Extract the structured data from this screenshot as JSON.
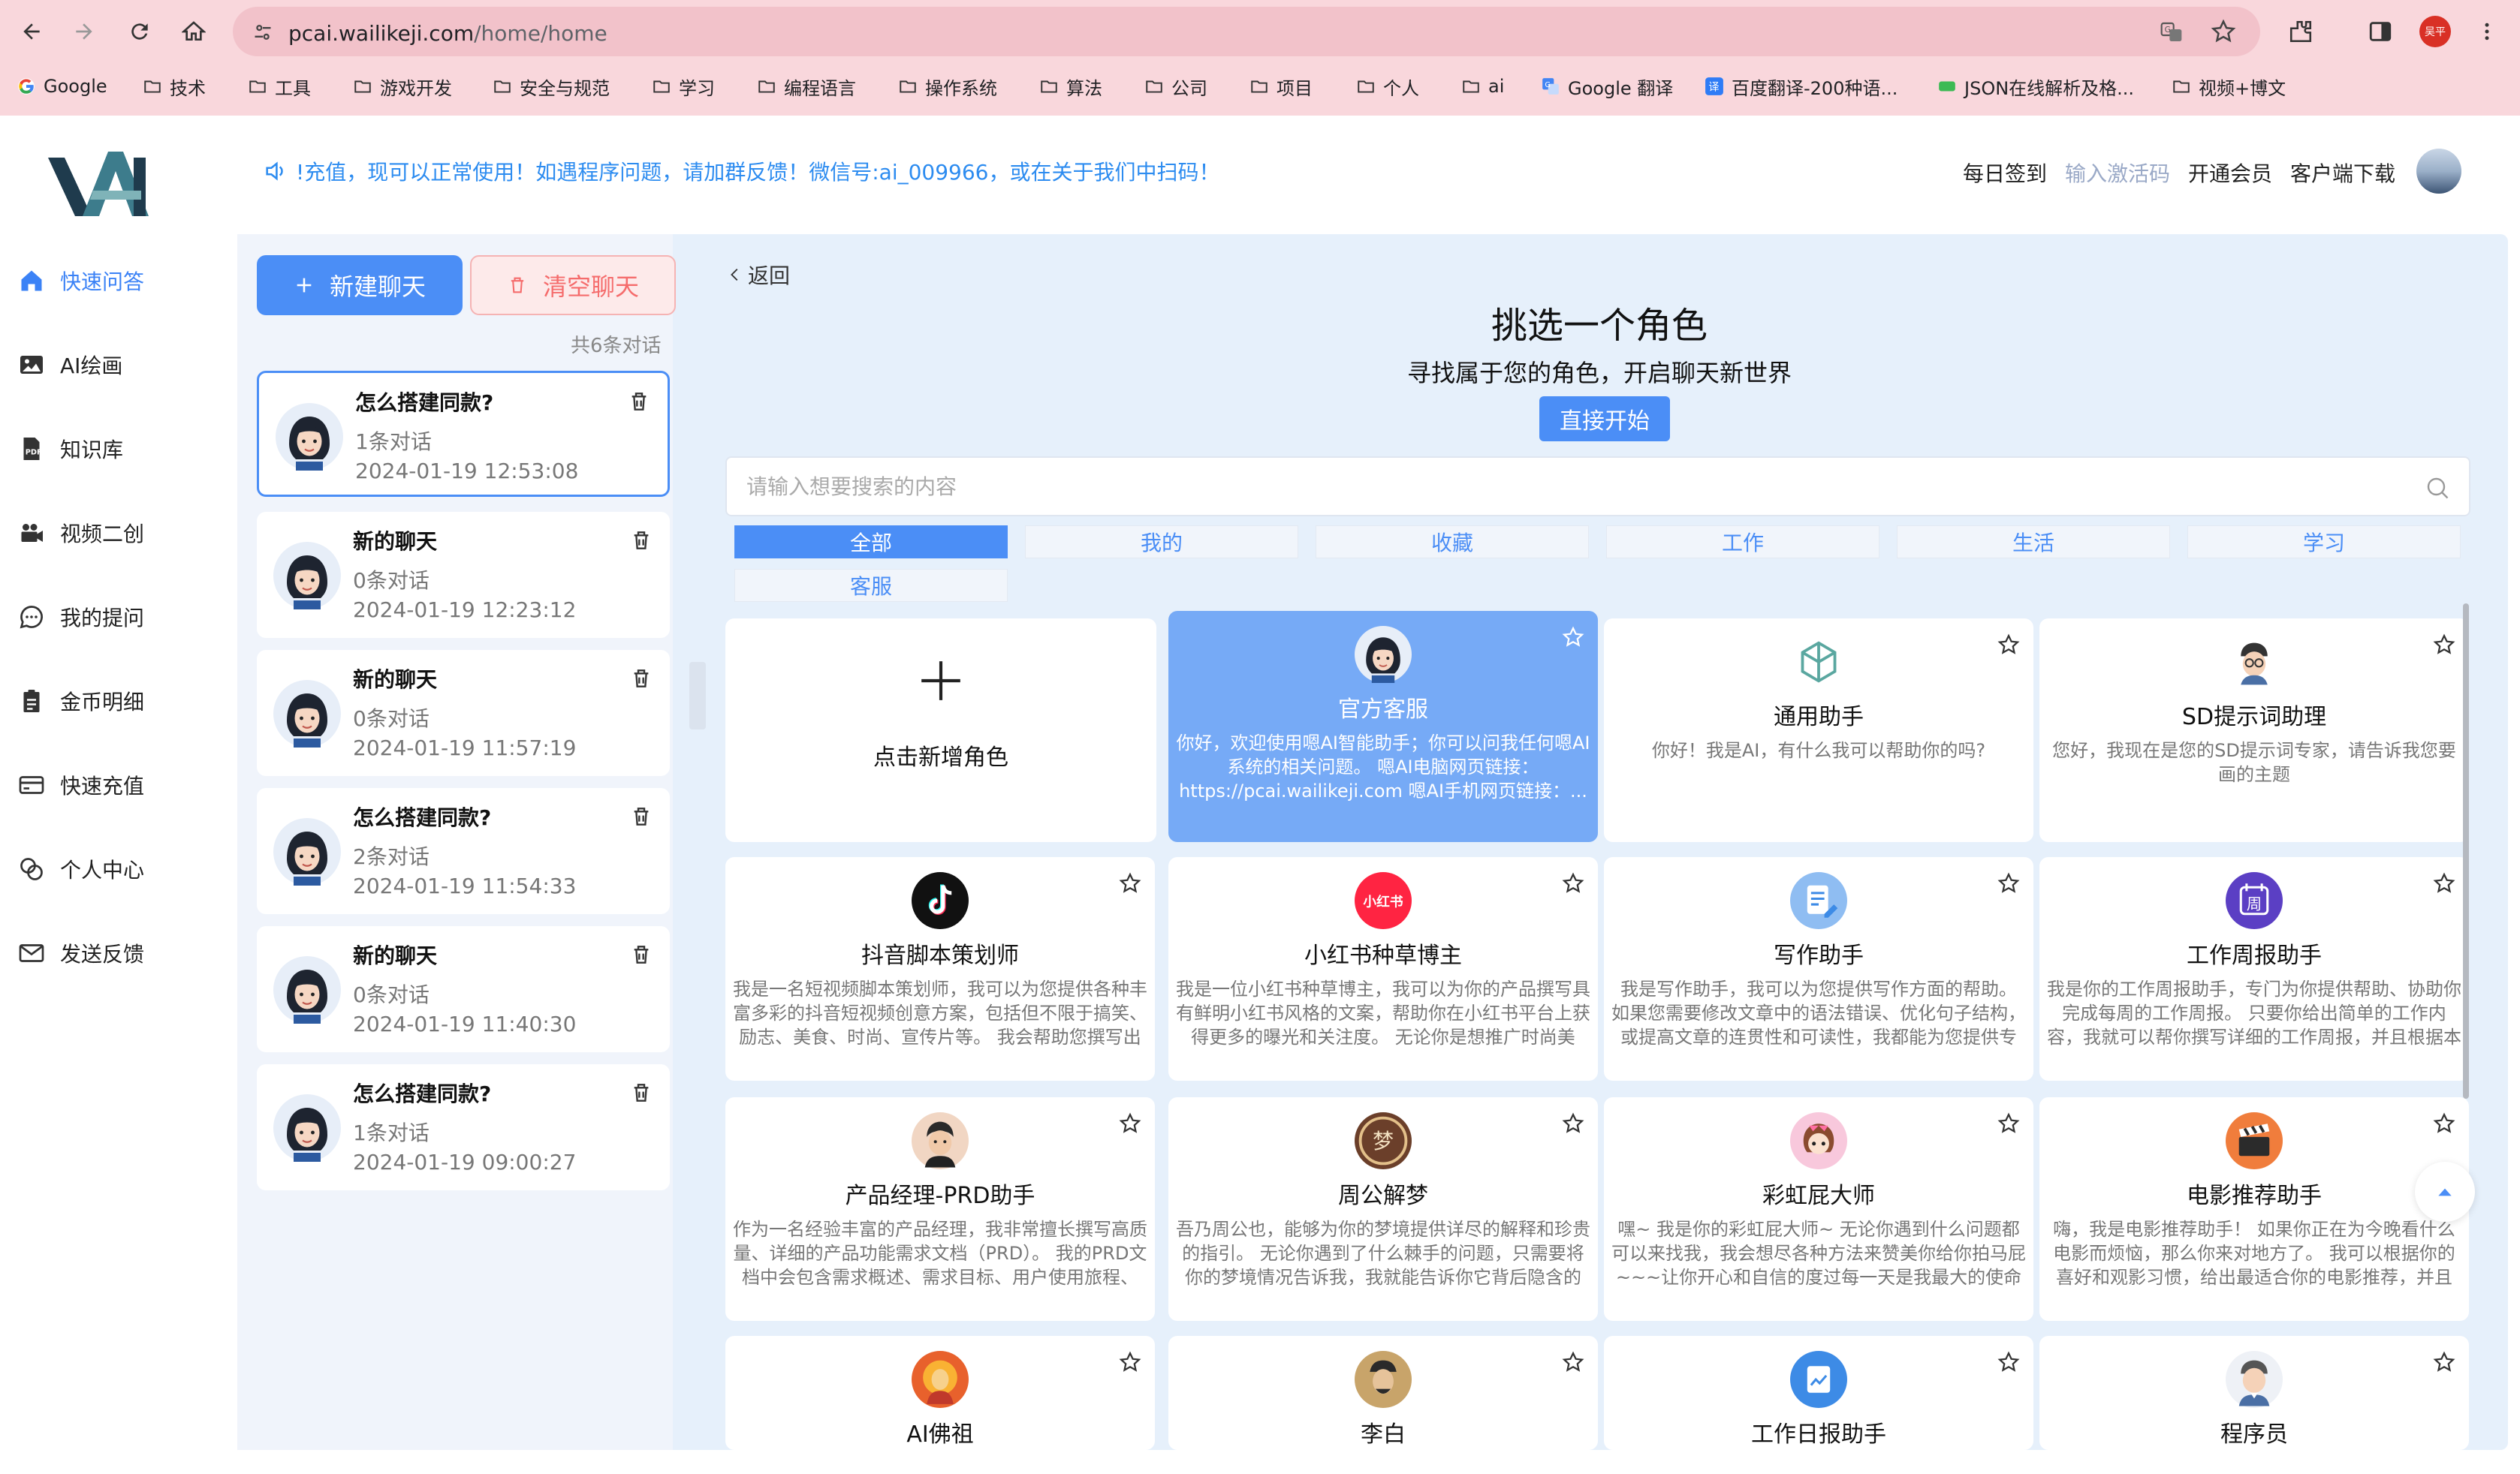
{
  "browser": {
    "url_host": "pcai.wailikeji.com",
    "url_path": "/home/home",
    "profile_label": "吴平",
    "bookmarks": [
      {
        "label": "Google",
        "icon": "google-icon"
      },
      {
        "label": "技术",
        "icon": "folder-icon"
      },
      {
        "label": "工具",
        "icon": "folder-icon"
      },
      {
        "label": "游戏开发",
        "icon": "folder-icon"
      },
      {
        "label": "安全与规范",
        "icon": "folder-icon"
      },
      {
        "label": "学习",
        "icon": "folder-icon"
      },
      {
        "label": "编程语言",
        "icon": "folder-icon"
      },
      {
        "label": "操作系统",
        "icon": "folder-icon"
      },
      {
        "label": "算法",
        "icon": "folder-icon"
      },
      {
        "label": "公司",
        "icon": "folder-icon"
      },
      {
        "label": "项目",
        "icon": "folder-icon"
      },
      {
        "label": "个人",
        "icon": "folder-icon"
      },
      {
        "label": "ai",
        "icon": "folder-icon"
      },
      {
        "label": "Google 翻译",
        "icon": "translate-icon"
      },
      {
        "label": "百度翻译-200种语...",
        "icon": "baidu-translate-icon"
      },
      {
        "label": "JSON在线解析及格...",
        "icon": "json-icon"
      },
      {
        "label": "视频+博文",
        "icon": "folder-icon"
      }
    ]
  },
  "sidebar": {
    "items": [
      {
        "label": "快速问答",
        "icon": "home-icon",
        "active": true
      },
      {
        "label": "AI绘画",
        "icon": "image-icon"
      },
      {
        "label": "知识库",
        "icon": "pdf-icon"
      },
      {
        "label": "视频二创",
        "icon": "video-camera-icon"
      },
      {
        "label": "我的提问",
        "icon": "chat-bubble-icon"
      },
      {
        "label": "金币明细",
        "icon": "clipboard-icon"
      },
      {
        "label": "快速充值",
        "icon": "card-icon"
      },
      {
        "label": "个人中心",
        "icon": "person-link-icon"
      },
      {
        "label": "发送反馈",
        "icon": "mail-icon"
      }
    ]
  },
  "header": {
    "notice": "!充值，现可以正常使用！如遇程序问题，请加群反馈！微信号:ai_009966，或在关于我们中扫码！",
    "nav": [
      "每日签到",
      "输入激活码",
      "开通会员",
      "客户端下载"
    ]
  },
  "chat_panel": {
    "new_chat_label": "新建聊天",
    "clear_chat_label": "清空聊天",
    "count_label": "共6条对话",
    "chats": [
      {
        "title": "怎么搭建同款?",
        "count": "1条对话",
        "time": "2024-01-19 12:53:08",
        "active": true
      },
      {
        "title": "新的聊天",
        "count": "0条对话",
        "time": "2024-01-19 12:23:12"
      },
      {
        "title": "新的聊天",
        "count": "0条对话",
        "time": "2024-01-19 11:57:19"
      },
      {
        "title": "怎么搭建同款?",
        "count": "2条对话",
        "time": "2024-01-19 11:54:33"
      },
      {
        "title": "新的聊天",
        "count": "0条对话",
        "time": "2024-01-19 11:40:30"
      },
      {
        "title": "怎么搭建同款?",
        "count": "1条对话",
        "time": "2024-01-19 09:00:27"
      }
    ]
  },
  "role_page": {
    "back_label": "返回",
    "title": "挑选一个角色",
    "subtitle": "寻找属于您的角色，开启聊天新世界",
    "start_label": "直接开始",
    "search_placeholder": "请输入想要搜索的内容",
    "tabs": [
      "全部",
      "我的",
      "收藏",
      "工作",
      "生活",
      "学习",
      "客服"
    ],
    "active_tab": "全部",
    "add_role_label": "点击新增角色",
    "cards": [
      {
        "name": "官方客服",
        "desc": "你好，欢迎使用嗯AI智能助手；你可以问我任何嗯AI系统的相关问题。 嗯AI电脑网页链接：https://pcai.wailikeji.com 嗯AI手机网页链接：...",
        "icon": "girl-avatar-icon",
        "highlighted": true
      },
      {
        "name": "通用助手",
        "desc": "你好！我是AI，有什么我可以帮助你的吗?",
        "icon": "openai-logo-icon"
      },
      {
        "name": "SD提示词助理",
        "desc": "您好，我现在是您的SD提示词专家，请告诉我您要画的主题",
        "icon": "glasses-boy-icon"
      },
      {
        "name": "抖音脚本策划师",
        "desc": "我是一名短视频脚本策划师，我可以为您提供各种丰富多彩的抖音短视频创意方案，包括但不限于搞笑、励志、美食、时尚、宣传片等。 我会帮助您撰写出优...",
        "icon": "tiktok-icon"
      },
      {
        "name": "小红书种草博主",
        "desc": "我是一位小红书种草博主，我可以为你的产品撰写具有鲜明小红书风格的文案，帮助你在小红书平台上获得更多的曝光和关注度。 无论你是想推广时尚美妆...",
        "icon": "xiaohongshu-icon"
      },
      {
        "name": "写作助手",
        "desc": "我是写作助手，我可以为您提供写作方面的帮助。 如果您需要修改文章中的语法错误、优化句子结构，或提高文章的连贯性和可读性，我都能为您提供专业...",
        "icon": "document-edit-icon"
      },
      {
        "name": "工作周报助手",
        "desc": "我是你的工作周报助手，专门为你提供帮助、协助你完成每周的工作周报。 只要你给出简单的工作内容，我就可以帮你撰写详细的工作周报，并且根据本周...",
        "icon": "calendar-week-icon"
      },
      {
        "name": "产品经理-PRD助手",
        "desc": "作为一名经验丰富的产品经理，我非常擅长撰写高质量、详细的产品功能需求文档（PRD）。 我的PRD文档中会包含需求概述、需求目标、用户使用旅程、功...",
        "icon": "manager-avatar-icon"
      },
      {
        "name": "周公解梦",
        "desc": "吾乃周公也，能够为你的梦境提供详尽的解释和珍贵的指引。 无论你遇到了什么棘手的问题，只需要将你的梦境情况告诉我，我就能告诉你它背后隐含的含...",
        "icon": "dream-icon"
      },
      {
        "name": "彩虹屁大师",
        "desc": "嘿~ 我是你的彩虹屁大师~ 无论你遇到什么问题都可以来找我，我会想尽各种方法来赞美你给你拍马屁~~~让你开心和自信的度过每一天是我最大的使命~~~~~",
        "icon": "cute-girl-icon"
      },
      {
        "name": "电影推荐助手",
        "desc": "嗨，我是电影推荐助手！ 如果你正在为今晚看什么电影而烦恼，那么你来对地方了。 我可以根据你的喜好和观影习惯，给出最适合你的电影推荐，并且持...",
        "icon": "clapperboard-icon"
      },
      {
        "name": "AI佛祖",
        "desc": "",
        "icon": "buddha-icon"
      },
      {
        "name": "李白",
        "desc": "",
        "icon": "poet-icon"
      },
      {
        "name": "工作日报助手",
        "desc": "",
        "icon": "daily-report-icon"
      },
      {
        "name": "程序员",
        "desc": "",
        "icon": "programmer-icon"
      }
    ]
  },
  "colors": {
    "accent": "#4b8ef6",
    "notice": "#2d8cf0",
    "danger": "#f56c6c",
    "panel_bg": "#e6f0fb",
    "chrome_bg": "#f9d7dc"
  }
}
